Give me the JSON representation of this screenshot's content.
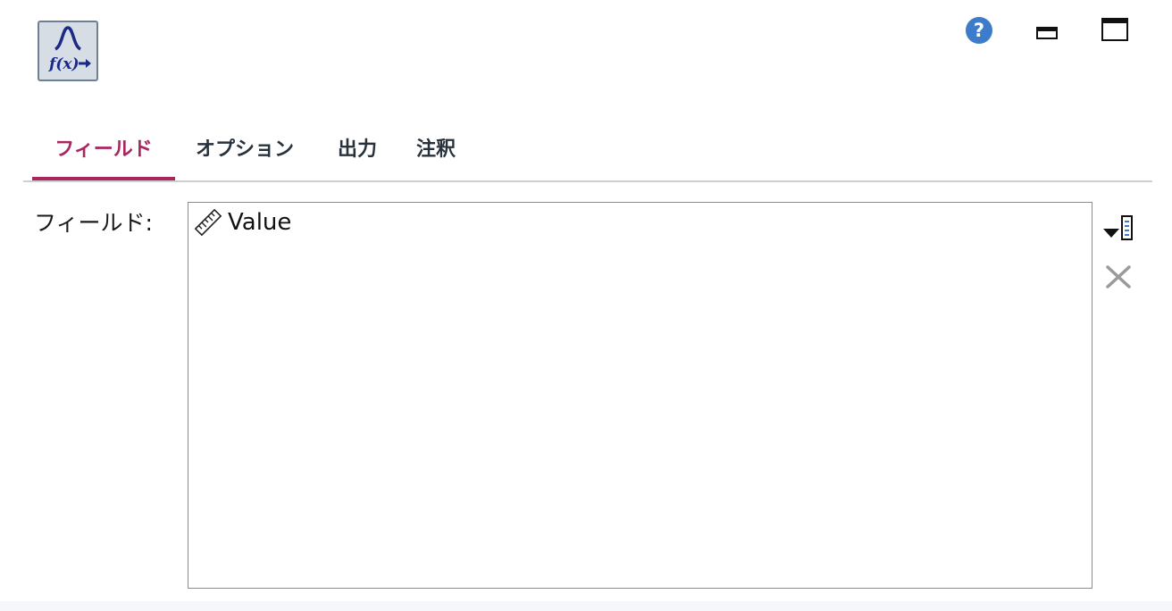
{
  "node": {
    "icon": "distribution-function-icon",
    "glyph_text": "f(x)"
  },
  "window_controls": {
    "help_icon": "help-icon",
    "minimize_icon": "minimize-icon",
    "maximize_icon": "maximize-icon"
  },
  "tabs": [
    {
      "label": "フィールド",
      "active": true
    },
    {
      "label": "オプション",
      "active": false
    },
    {
      "label": "出力",
      "active": false
    },
    {
      "label": "注釈",
      "active": false
    }
  ],
  "fields_panel": {
    "label": "フィールド:",
    "items": [
      {
        "name": "Value",
        "icon": "continuous-measure-icon"
      }
    ],
    "buttons": {
      "pick_fields_icon": "field-picker-icon",
      "remove_field_icon": "remove-icon"
    }
  },
  "colors": {
    "accent": "#a8275f",
    "tab_text": "#28323c",
    "help_blue": "#3d7cc9"
  }
}
